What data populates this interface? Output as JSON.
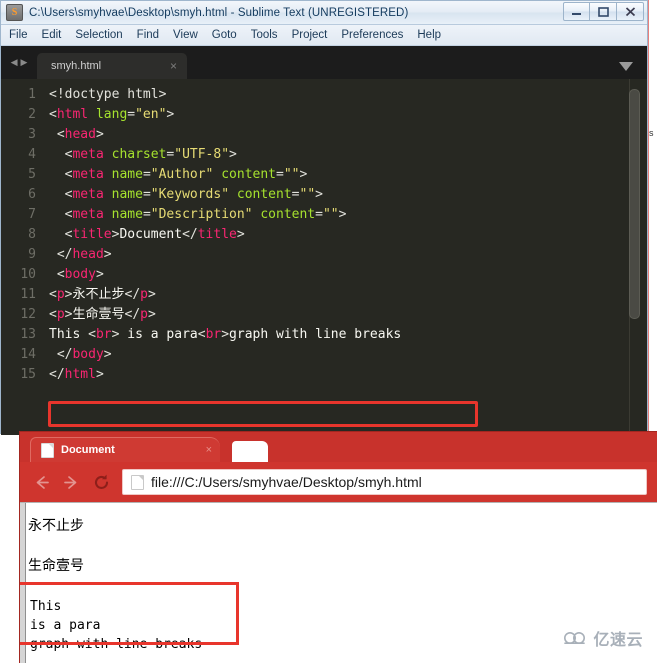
{
  "editor_window": {
    "title": "C:\\Users\\smyhvae\\Desktop\\smyh.html - Sublime Text (UNREGISTERED)",
    "app_icon": "S",
    "window_controls": {
      "minimize": "minimize-icon",
      "maximize": "maximize-icon",
      "close": "close-icon"
    },
    "menu": [
      {
        "label": "File"
      },
      {
        "label": "Edit"
      },
      {
        "label": "Selection"
      },
      {
        "label": "Find"
      },
      {
        "label": "View"
      },
      {
        "label": "Goto"
      },
      {
        "label": "Tools"
      },
      {
        "label": "Project"
      },
      {
        "label": "Preferences"
      },
      {
        "label": "Help"
      }
    ],
    "tab": {
      "label": "smyh.html",
      "close": "×",
      "prev_arrow": "◀",
      "next_arrow": "▶",
      "dropdown": "chevron-down-icon"
    },
    "gutter": [
      "1",
      "2",
      "3",
      "4",
      "5",
      "6",
      "7",
      "8",
      "9",
      "10",
      "11",
      "12",
      "13",
      "14",
      "15"
    ],
    "code_lines": [
      {
        "n": 1,
        "indent": "",
        "tokens": [
          {
            "t": "doctype",
            "v": "<!doctype html>"
          }
        ]
      },
      {
        "n": 2,
        "indent": "",
        "tokens": [
          {
            "t": "punct",
            "v": "<"
          },
          {
            "t": "tag",
            "v": "html"
          },
          {
            "t": "text",
            "v": " "
          },
          {
            "t": "attr",
            "v": "lang"
          },
          {
            "t": "punct",
            "v": "="
          },
          {
            "t": "string",
            "v": "\"en\""
          },
          {
            "t": "punct",
            "v": ">"
          }
        ]
      },
      {
        "n": 3,
        "indent": " ",
        "tokens": [
          {
            "t": "punct",
            "v": "<"
          },
          {
            "t": "tag",
            "v": "head"
          },
          {
            "t": "punct",
            "v": ">"
          }
        ]
      },
      {
        "n": 4,
        "indent": "  ",
        "tokens": [
          {
            "t": "punct",
            "v": "<"
          },
          {
            "t": "tag",
            "v": "meta"
          },
          {
            "t": "text",
            "v": " "
          },
          {
            "t": "attr",
            "v": "charset"
          },
          {
            "t": "punct",
            "v": "="
          },
          {
            "t": "string",
            "v": "\"UTF-8\""
          },
          {
            "t": "punct",
            "v": ">"
          }
        ]
      },
      {
        "n": 5,
        "indent": "  ",
        "tokens": [
          {
            "t": "punct",
            "v": "<"
          },
          {
            "t": "tag",
            "v": "meta"
          },
          {
            "t": "text",
            "v": " "
          },
          {
            "t": "attr",
            "v": "name"
          },
          {
            "t": "punct",
            "v": "="
          },
          {
            "t": "string",
            "v": "\"Author\""
          },
          {
            "t": "text",
            "v": " "
          },
          {
            "t": "attr",
            "v": "content"
          },
          {
            "t": "punct",
            "v": "="
          },
          {
            "t": "string",
            "v": "\"\""
          },
          {
            "t": "punct",
            "v": ">"
          }
        ]
      },
      {
        "n": 6,
        "indent": "  ",
        "tokens": [
          {
            "t": "punct",
            "v": "<"
          },
          {
            "t": "tag",
            "v": "meta"
          },
          {
            "t": "text",
            "v": " "
          },
          {
            "t": "attr",
            "v": "name"
          },
          {
            "t": "punct",
            "v": "="
          },
          {
            "t": "string",
            "v": "\"Keywords\""
          },
          {
            "t": "text",
            "v": " "
          },
          {
            "t": "attr",
            "v": "content"
          },
          {
            "t": "punct",
            "v": "="
          },
          {
            "t": "string",
            "v": "\"\""
          },
          {
            "t": "punct",
            "v": ">"
          }
        ]
      },
      {
        "n": 7,
        "indent": "  ",
        "tokens": [
          {
            "t": "punct",
            "v": "<"
          },
          {
            "t": "tag",
            "v": "meta"
          },
          {
            "t": "text",
            "v": " "
          },
          {
            "t": "attr",
            "v": "name"
          },
          {
            "t": "punct",
            "v": "="
          },
          {
            "t": "string",
            "v": "\"Description\""
          },
          {
            "t": "text",
            "v": " "
          },
          {
            "t": "attr",
            "v": "content"
          },
          {
            "t": "punct",
            "v": "="
          },
          {
            "t": "string",
            "v": "\"\""
          },
          {
            "t": "punct",
            "v": ">"
          }
        ]
      },
      {
        "n": 8,
        "indent": "  ",
        "tokens": [
          {
            "t": "punct",
            "v": "<"
          },
          {
            "t": "tag",
            "v": "title"
          },
          {
            "t": "punct",
            "v": ">"
          },
          {
            "t": "text",
            "v": "Document"
          },
          {
            "t": "punct",
            "v": "</"
          },
          {
            "t": "tag",
            "v": "title"
          },
          {
            "t": "punct",
            "v": ">"
          }
        ]
      },
      {
        "n": 9,
        "indent": " ",
        "tokens": [
          {
            "t": "punct",
            "v": "</"
          },
          {
            "t": "tag",
            "v": "head"
          },
          {
            "t": "punct",
            "v": ">"
          }
        ]
      },
      {
        "n": 10,
        "indent": " ",
        "tokens": [
          {
            "t": "punct",
            "v": "<"
          },
          {
            "t": "tag",
            "v": "body"
          },
          {
            "t": "punct",
            "v": ">"
          }
        ]
      },
      {
        "n": 11,
        "indent": "",
        "tokens": [
          {
            "t": "punct",
            "v": "<"
          },
          {
            "t": "tag",
            "v": "p"
          },
          {
            "t": "punct",
            "v": ">"
          },
          {
            "t": "text",
            "v": "永不止步"
          },
          {
            "t": "punct",
            "v": "</"
          },
          {
            "t": "tag",
            "v": "p"
          },
          {
            "t": "punct",
            "v": ">"
          }
        ]
      },
      {
        "n": 12,
        "indent": "",
        "tokens": [
          {
            "t": "punct",
            "v": "<"
          },
          {
            "t": "tag",
            "v": "p"
          },
          {
            "t": "punct",
            "v": ">"
          },
          {
            "t": "text",
            "v": "生命壹号"
          },
          {
            "t": "punct",
            "v": "</"
          },
          {
            "t": "tag",
            "v": "p"
          },
          {
            "t": "punct",
            "v": ">"
          }
        ]
      },
      {
        "n": 13,
        "indent": "",
        "tokens": [
          {
            "t": "text",
            "v": "This "
          },
          {
            "t": "punct",
            "v": "<"
          },
          {
            "t": "tag",
            "v": "br"
          },
          {
            "t": "punct",
            "v": ">"
          },
          {
            "t": "text",
            "v": " is a para"
          },
          {
            "t": "punct",
            "v": "<"
          },
          {
            "t": "tag",
            "v": "br"
          },
          {
            "t": "punct",
            "v": ">"
          },
          {
            "t": "text",
            "v": "graph with line breaks"
          }
        ]
      },
      {
        "n": 14,
        "indent": " ",
        "tokens": [
          {
            "t": "punct",
            "v": "</"
          },
          {
            "t": "tag",
            "v": "body"
          },
          {
            "t": "punct",
            "v": ">"
          }
        ]
      },
      {
        "n": 15,
        "indent": "",
        "tokens": [
          {
            "t": "punct",
            "v": "</"
          },
          {
            "t": "tag",
            "v": "html"
          },
          {
            "t": "punct",
            "v": ">"
          }
        ]
      }
    ],
    "annotation_color": "#e8352c"
  },
  "browser_window": {
    "theme_color": "#c8322c",
    "tab": {
      "title": "Document",
      "close": "×",
      "favicon": "page-icon"
    },
    "new_tab_label": "",
    "toolbar": {
      "back": "back-arrow-icon",
      "forward": "forward-arrow-icon",
      "reload": "reload-icon",
      "url": "file:///C:/Users/smyhvae/Desktop/smyh.html"
    },
    "page": {
      "para1": "永不止步",
      "para2": "生命壹号",
      "text_block": "This\nis a para\ngraph with line breaks"
    }
  },
  "watermark": {
    "text": "亿速云",
    "icon": "cloud-icon"
  }
}
